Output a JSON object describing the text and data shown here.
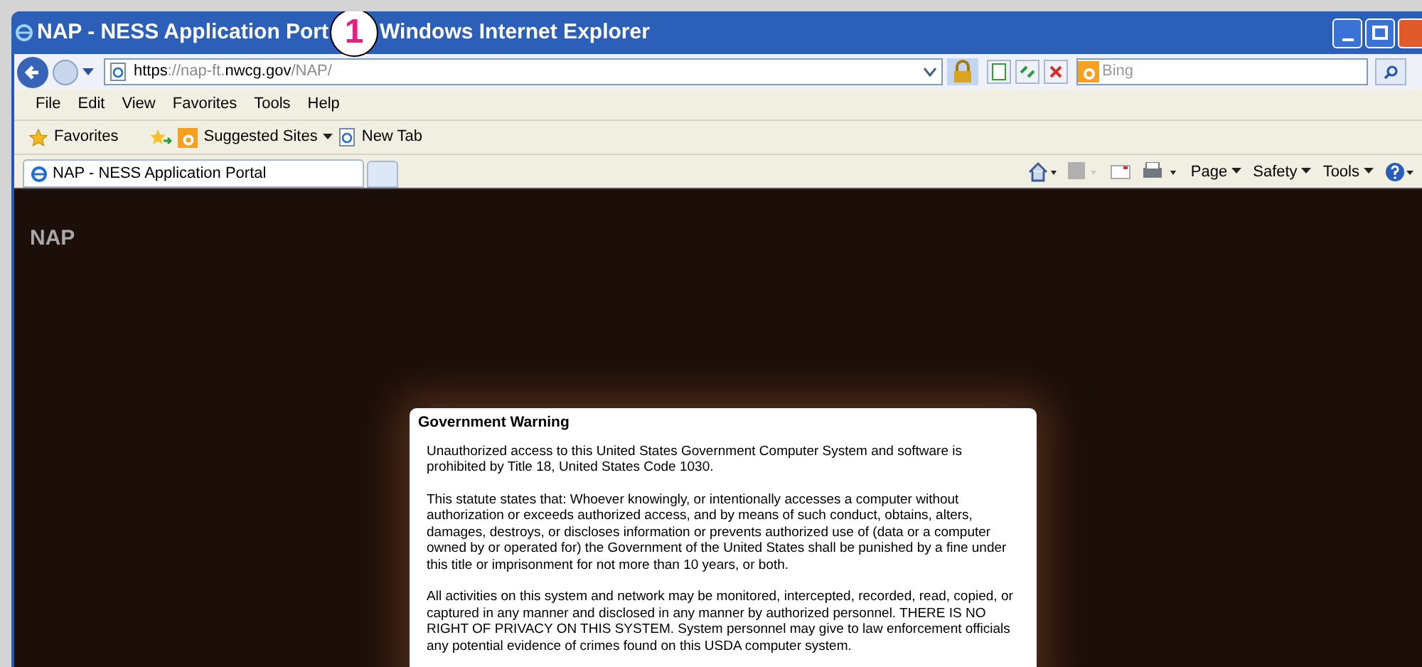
{
  "window": {
    "title_parts": [
      "NAP - NESS Application Port",
      "Windows Internet Explorer"
    ],
    "callout": "1"
  },
  "address_bar": {
    "url_scheme": "https",
    "url_rest": "://nap-ft.",
    "url_host": "nwcg.gov",
    "url_path": "/NAP/",
    "search_placeholder": "Bing"
  },
  "menu_bar": [
    "File",
    "Edit",
    "View",
    "Favorites",
    "Tools",
    "Help"
  ],
  "favorites_bar": {
    "favorites": "Favorites",
    "items": [
      {
        "kind": "suggested",
        "label": "Suggested Sites"
      },
      {
        "kind": "page",
        "label": "New Tab"
      }
    ]
  },
  "tabs": [
    {
      "label": "NAP - NESS Application Portal",
      "selected": true
    }
  ],
  "command_bar": [
    "Page",
    "Safety",
    "Tools"
  ],
  "page": {
    "app_name": "NAP",
    "dialog": {
      "title": "Government Warning",
      "paragraphs": [
        "Unauthorized access to this United States Government Computer System and software is prohibited by Title 18, United States Code 1030.",
        "This statute states that: Whoever knowingly, or intentionally accesses a computer without authorization or exceeds authorized access, and by means of such conduct, obtains, alters, damages, destroys, or discloses information or prevents authorized use of (data or a computer owned by or operated for) the Government of the United States shall be punished by a fine under this title or imprisonment for not more than 10 years, or both.",
        "All activities on this system and network may be monitored, intercepted, recorded, read, copied, or captured in any manner and disclosed in any manner by authorized personnel. THERE IS NO RIGHT OF PRIVACY ON THIS SYSTEM. System personnel may give to law enforcement officials any potential evidence of crimes found on this USDA computer system."
      ]
    }
  }
}
